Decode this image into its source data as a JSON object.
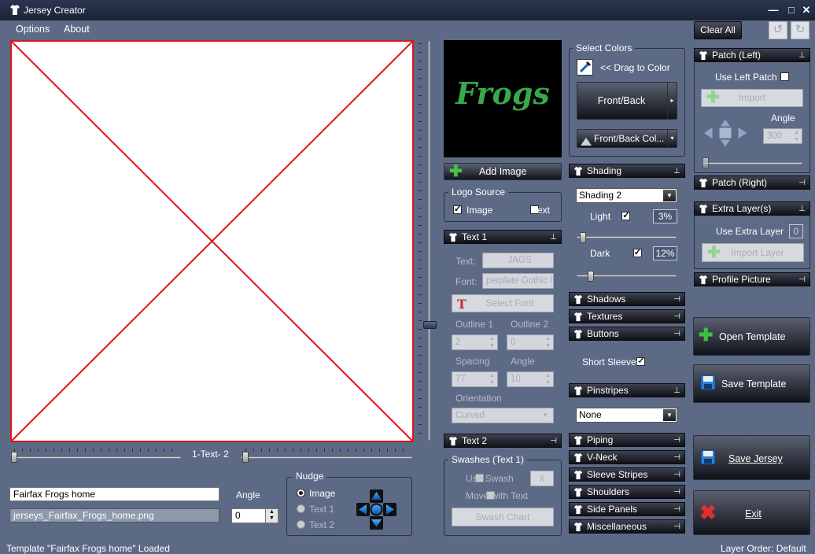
{
  "window": {
    "title": "Jersey Creator",
    "minimize": "—",
    "maximize": "□",
    "close": "✕"
  },
  "menu": {
    "options": "Options",
    "about": "About"
  },
  "toolbar": {
    "clear_all": "Clear All"
  },
  "preview": {
    "logo_text": "Frogs",
    "logo_color": "#3aa84a"
  },
  "canvas_controls": {
    "layer_label": "1-Text- 2",
    "template_name": "Fairfax Frogs home",
    "file_name": "jerseys_Fairfax_Frogs_home.png",
    "angle_label": "Angle",
    "angle_value": "0"
  },
  "nudge": {
    "title": "Nudge",
    "image": "Image",
    "text1": "Text 1",
    "text2": "Text 2"
  },
  "middle": {
    "add_image": "Add Image",
    "logo_source": {
      "title": "Logo Source",
      "image": "Image",
      "text": "Text"
    },
    "text1": {
      "header": "Text 1",
      "text_label": "Text:",
      "text_value": "JAGS",
      "font_label": "Font:",
      "font_value": "perplate Gothic I",
      "select_font": "Select Font",
      "outline1": "Outline 1",
      "outline2": "Outline 2",
      "outline1_value": "2",
      "outline2_value": "0",
      "spacing": "Spacing",
      "angle": "Angle",
      "spacing_value": "77",
      "angle_value": "10",
      "orientation": "Orientation",
      "orientation_value": "Curved"
    },
    "text2": {
      "header": "Text 2"
    },
    "swashes": {
      "title": "Swashes (Text 1)",
      "use_swash": "Use Swash",
      "x": "X",
      "move_with_text": "Move with Text",
      "swash_chart": "Swash Chart"
    }
  },
  "colors": {
    "title": "Select Colors",
    "drag": "<< Drag to Color",
    "front_back": "Front/Back",
    "front_back_col": "Front/Back Col..."
  },
  "shading": {
    "header": "Shading",
    "select": "Shading 2",
    "light": "Light",
    "light_value": "3%",
    "dark": "Dark",
    "dark_value": "12%"
  },
  "panels": {
    "shadows": "Shadows",
    "textures": "Textures",
    "buttons": "Buttons",
    "short_sleeves": "Short Sleeves",
    "pinstripes": "Pinstripes",
    "pinstripes_value": "None",
    "piping": "Piping",
    "vneck": "V-Neck",
    "sleeve_stripes": "Sleeve Stripes",
    "shoulders": "Shoulders",
    "side_panels": "Side Panels",
    "misc": "Miscellaneous"
  },
  "patch_left": {
    "header": "Patch (Left)",
    "use": "Use Left Patch",
    "import": "Import",
    "angle": "Angle",
    "angle_value": "300"
  },
  "patch_right": {
    "header": "Patch (Right)"
  },
  "extra": {
    "header": "Extra Layer(s)",
    "use": "Use Extra Layer",
    "count": "0",
    "import": "Import Layer"
  },
  "profile": {
    "header": "Profile Picture"
  },
  "actions": {
    "open_template": "Open Template",
    "save_template": "Save Template",
    "save_jersey": "Save Jersey",
    "exit": "Exit"
  },
  "status": {
    "left": "Template \"Fairfax Frogs home\" Loaded",
    "right": "Layer Order: Default"
  },
  "icons": {
    "pin": "⇣",
    "unpin": "⇤",
    "shirt": "shirt-icon",
    "plus": "plus-icon"
  }
}
